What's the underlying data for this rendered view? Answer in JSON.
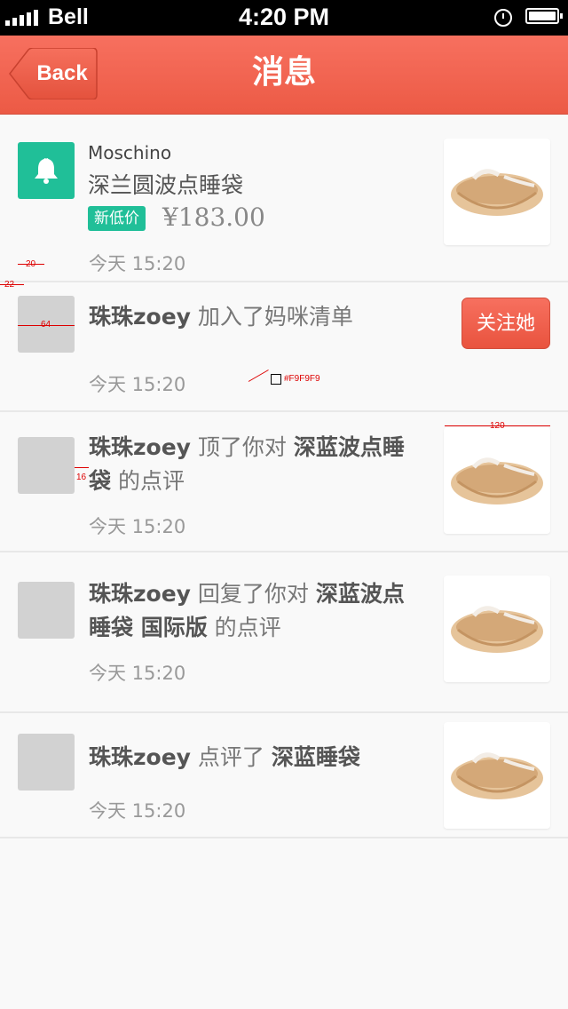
{
  "status_bar": {
    "carrier": "Bell",
    "time": "4:20 PM"
  },
  "nav": {
    "back_label": "Back",
    "title": "消息"
  },
  "notifications": [
    {
      "type": "price-drop",
      "brand": "Moschino",
      "product": "深兰圆波点睡袋",
      "badge": "新低价",
      "price": "¥183.00",
      "time": "今天 15:20"
    },
    {
      "type": "follow",
      "user": "珠珠zoey",
      "action": " 加入了妈咪清单",
      "follow_label": "关注她",
      "time": "今天 15:20"
    },
    {
      "type": "like",
      "user": "珠珠zoey",
      "action": " 顶了你对 ",
      "item": "深蓝波点睡袋",
      "suffix": " 的点评",
      "time": "今天 15:20"
    },
    {
      "type": "reply",
      "user": "珠珠zoey",
      "action": " 回复了你对 ",
      "item": "深蓝波点睡袋 国际版",
      "suffix": " 的点评",
      "time": "今天 15:20"
    },
    {
      "type": "review",
      "user": "珠珠zoey",
      "action": " 点评了 ",
      "item": "深蓝睡袋",
      "suffix": "",
      "time": "今天 15:20"
    }
  ],
  "annotations": {
    "margin_20": "20",
    "margin_22": "22",
    "avatar_size": "64",
    "bg_color": "#F9F9F9",
    "gap_16": "16",
    "thumb_size": "120"
  },
  "icons": {
    "bell": "bell-icon",
    "basket": "basket-image"
  }
}
